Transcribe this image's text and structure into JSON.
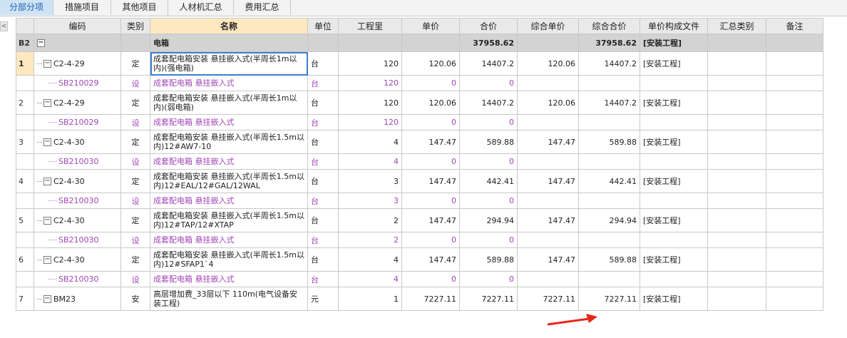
{
  "tabs": [
    "分部分项",
    "措施项目",
    "其他项目",
    "人材机汇总",
    "费用汇总"
  ],
  "side_toggle": "<",
  "columns": [
    "编码",
    "类别",
    "名称",
    "单位",
    "工程里",
    "单价",
    "合价",
    "综合单价",
    "综合合价",
    "单价构成文件",
    "汇总类别",
    "备注"
  ],
  "group": {
    "id": "B2",
    "name": "电箱",
    "total": "37958.62",
    "comp_total": "37958.62",
    "file": "[安装工程]"
  },
  "rows": [
    {
      "kind": "main",
      "num": "1",
      "code": "C2-4-29",
      "cat": "定",
      "name": "成套配电箱安装 悬挂嵌入式(半周长1m以内)(强电箱)",
      "unit": "台",
      "qty": "120",
      "price": "120.06",
      "total": "14407.2",
      "comp_price": "120.06",
      "comp_total": "14407.2",
      "file": "[安装工程]"
    },
    {
      "kind": "sub",
      "num": "",
      "code": "SB210029",
      "cat": "设",
      "name": "成套配电箱 悬挂嵌入式",
      "unit": "台",
      "qty": "120",
      "price": "0",
      "total": "0",
      "comp_price": "",
      "comp_total": "",
      "file": ""
    },
    {
      "kind": "main",
      "num": "2",
      "code": "C2-4-29",
      "cat": "定",
      "name": "成套配电箱安装 悬挂嵌入式(半周长1m以内)(弱电箱)",
      "unit": "台",
      "qty": "120",
      "price": "120.06",
      "total": "14407.2",
      "comp_price": "120.06",
      "comp_total": "14407.2",
      "file": "[安装工程]"
    },
    {
      "kind": "sub",
      "num": "",
      "code": "SB210029",
      "cat": "设",
      "name": "成套配电箱 悬挂嵌入式",
      "unit": "台",
      "qty": "120",
      "price": "0",
      "total": "0",
      "comp_price": "",
      "comp_total": "",
      "file": ""
    },
    {
      "kind": "main",
      "num": "3",
      "code": "C2-4-30",
      "cat": "定",
      "name": "成套配电箱安装 悬挂嵌入式(半周长1.5m以内)12#AW7-10",
      "unit": "台",
      "qty": "4",
      "price": "147.47",
      "total": "589.88",
      "comp_price": "147.47",
      "comp_total": "589.88",
      "file": "[安装工程]"
    },
    {
      "kind": "sub",
      "num": "",
      "code": "SB210030",
      "cat": "设",
      "name": "成套配电箱 悬挂嵌入式",
      "unit": "台",
      "qty": "4",
      "price": "0",
      "total": "0",
      "comp_price": "",
      "comp_total": "",
      "file": ""
    },
    {
      "kind": "main",
      "num": "4",
      "code": "C2-4-30",
      "cat": "定",
      "name": "成套配电箱安装 悬挂嵌入式(半周长1.5m以内)12#EAL/12#GAL/12WAL",
      "unit": "台",
      "qty": "3",
      "price": "147.47",
      "total": "442.41",
      "comp_price": "147.47",
      "comp_total": "442.41",
      "file": "[安装工程]"
    },
    {
      "kind": "sub",
      "num": "",
      "code": "SB210030",
      "cat": "设",
      "name": "成套配电箱 悬挂嵌入式",
      "unit": "台",
      "qty": "3",
      "price": "0",
      "total": "0",
      "comp_price": "",
      "comp_total": "",
      "file": ""
    },
    {
      "kind": "main",
      "num": "5",
      "code": "C2-4-30",
      "cat": "定",
      "name": "成套配电箱安装 悬挂嵌入式(半周长1.5m以内)12#TAP/12#XTAP",
      "unit": "台",
      "qty": "2",
      "price": "147.47",
      "total": "294.94",
      "comp_price": "147.47",
      "comp_total": "294.94",
      "file": "[安装工程]"
    },
    {
      "kind": "sub",
      "num": "",
      "code": "SB210030",
      "cat": "设",
      "name": "成套配电箱 悬挂嵌入式",
      "unit": "台",
      "qty": "2",
      "price": "0",
      "total": "0",
      "comp_price": "",
      "comp_total": "",
      "file": ""
    },
    {
      "kind": "main",
      "num": "6",
      "code": "C2-4-30",
      "cat": "定",
      "name": "成套配电箱安装 悬挂嵌入式(半周长1.5m以内)12#SFAP1`4",
      "unit": "台",
      "qty": "4",
      "price": "147.47",
      "total": "589.88",
      "comp_price": "147.47",
      "comp_total": "589.88",
      "file": "[安装工程]"
    },
    {
      "kind": "sub",
      "num": "",
      "code": "SB210030",
      "cat": "设",
      "name": "成套配电箱 悬挂嵌入式",
      "unit": "台",
      "qty": "4",
      "price": "0",
      "total": "0",
      "comp_price": "",
      "comp_total": "",
      "file": ""
    },
    {
      "kind": "main",
      "num": "7",
      "code": "BM23",
      "cat": "安",
      "name": "高层增加费_33层以下 110m(电气设备安装工程)",
      "unit": "元",
      "qty": "1",
      "price": "7227.11",
      "total": "7227.11",
      "comp_price": "7227.11",
      "comp_total": "7227.11",
      "file": "[安装工程]"
    }
  ],
  "colors": {
    "tab_active": "#cfe3f6",
    "name_header": "#fde8c0",
    "sub_text": "#a046b6",
    "group_bg": "#d3d3d3",
    "arrow": "#e8261b"
  }
}
